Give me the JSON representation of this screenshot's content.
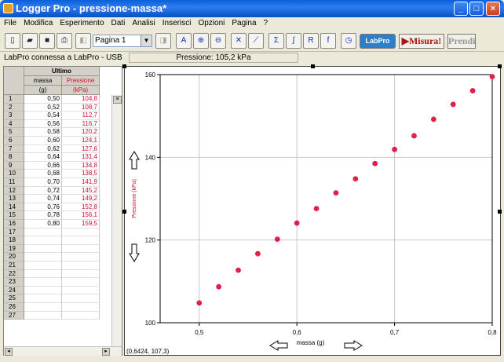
{
  "window": {
    "title": "Logger Pro - pressione-massa*"
  },
  "menu": [
    "File",
    "Modifica",
    "Esperimento",
    "Dati",
    "Analisi",
    "Inserisci",
    "Opzioni",
    "Pagina",
    "?"
  ],
  "toolbar": {
    "page_select": "Pagina 1",
    "labpro_label": "LabPro",
    "misura_label": "Misura!",
    "prendi_label": "Prendi"
  },
  "status": {
    "connection": "LabPro connessa a LabPro - USB",
    "live_reading": "Pressione: 105,2 kPa"
  },
  "table": {
    "dataset_name": "Ultimo",
    "columns": [
      {
        "name": "massa",
        "unit": "(g)"
      },
      {
        "name": "Pressione",
        "unit": "(kPa)"
      }
    ],
    "row_numbers": [
      "1",
      "2",
      "3",
      "4",
      "5",
      "6",
      "7",
      "8",
      "9",
      "10",
      "11",
      "12",
      "13",
      "14",
      "15",
      "16",
      "17",
      "18",
      "19",
      "20",
      "21",
      "22",
      "23",
      "24",
      "25",
      "26",
      "27"
    ],
    "massa": [
      "0,50",
      "0,52",
      "0,54",
      "0,56",
      "0,58",
      "0,60",
      "0,62",
      "0,64",
      "0,66",
      "0,68",
      "0,70",
      "0,72",
      "0,74",
      "0,76",
      "0,78",
      "0,80"
    ],
    "pressione": [
      "104,8",
      "108,7",
      "112,7",
      "116,7",
      "120,2",
      "124,1",
      "127,6",
      "131,4",
      "134,8",
      "138,5",
      "141,9",
      "145,2",
      "149,2",
      "152,8",
      "156,1",
      "159,5"
    ]
  },
  "graph": {
    "coordinate_readout": "(0,6424, 107,3)",
    "point_color": "#e0204a"
  },
  "chart_data": {
    "type": "scatter",
    "x": [
      0.5,
      0.52,
      0.54,
      0.56,
      0.58,
      0.6,
      0.62,
      0.64,
      0.66,
      0.68,
      0.7,
      0.72,
      0.74,
      0.76,
      0.78,
      0.8
    ],
    "y": [
      104.8,
      108.7,
      112.7,
      116.7,
      120.2,
      124.1,
      127.6,
      131.4,
      134.8,
      138.5,
      141.9,
      145.2,
      149.2,
      152.8,
      156.1,
      159.5
    ],
    "xlabel": "massa (g)",
    "ylabel": "Pressione (kPa)",
    "xlim": [
      0.46,
      0.8
    ],
    "ylim": [
      100,
      160
    ],
    "xticks": [
      0.5,
      0.6,
      0.7,
      0.8
    ],
    "xtick_labels": [
      "0,5",
      "0,6",
      "0,7",
      "0,8"
    ],
    "yticks": [
      100,
      120,
      140,
      160
    ],
    "ytick_labels": [
      "100",
      "120",
      "140",
      "160"
    ],
    "grid": true
  }
}
